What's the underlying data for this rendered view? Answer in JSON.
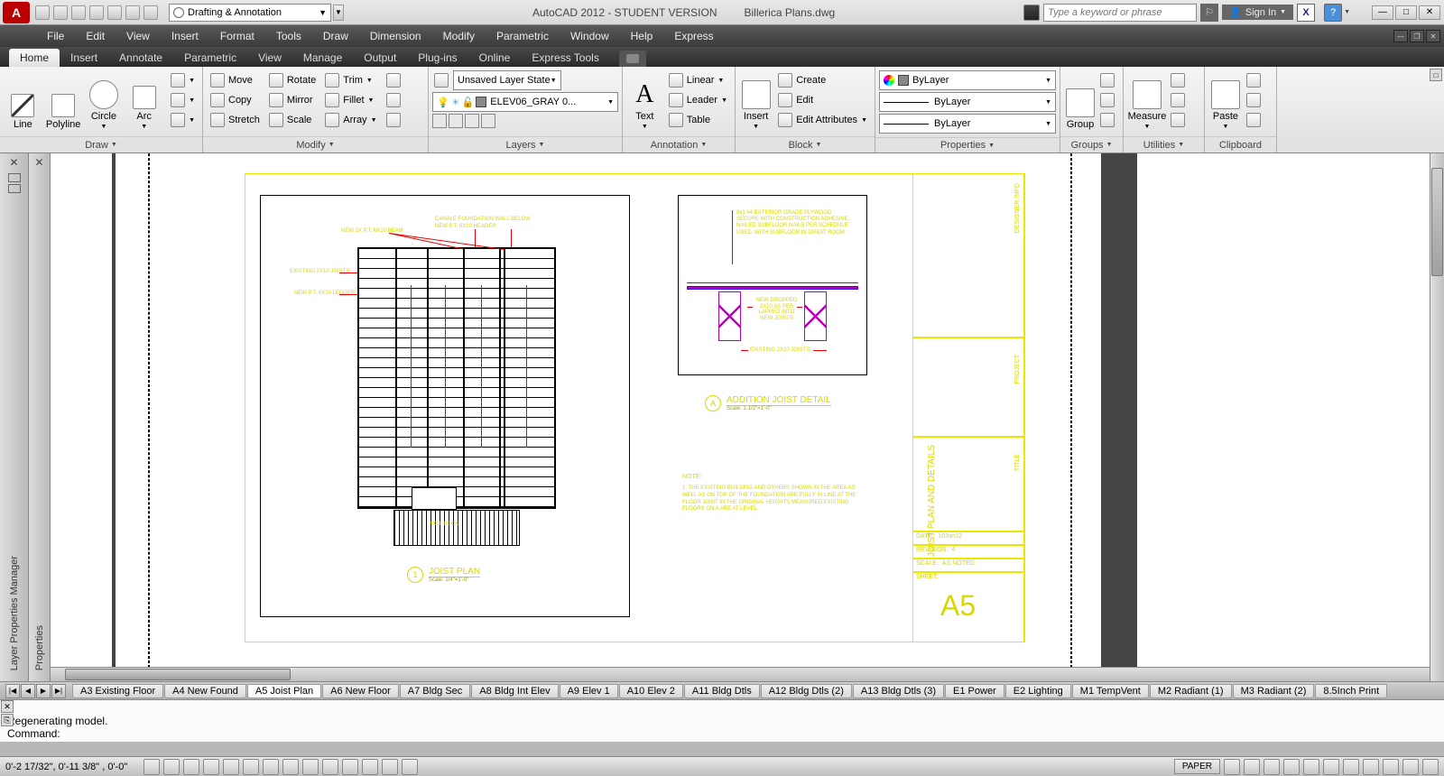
{
  "title": {
    "app": "AutoCAD 2012 - STUDENT VERSION",
    "file": "Billerica Plans.dwg"
  },
  "workspace": "Drafting & Annotation",
  "search": {
    "placeholder": "Type a keyword or phrase"
  },
  "signin": "Sign In",
  "menus": [
    "File",
    "Edit",
    "View",
    "Insert",
    "Format",
    "Tools",
    "Draw",
    "Dimension",
    "Modify",
    "Parametric",
    "Window",
    "Help",
    "Express"
  ],
  "tabs": [
    "Home",
    "Insert",
    "Annotate",
    "Parametric",
    "View",
    "Manage",
    "Output",
    "Plug-ins",
    "Online",
    "Express Tools"
  ],
  "active_tab": "Home",
  "ribbon": {
    "draw": {
      "title": "Draw",
      "line": "Line",
      "polyline": "Polyline",
      "circle": "Circle",
      "arc": "Arc"
    },
    "modify": {
      "title": "Modify",
      "move": "Move",
      "copy": "Copy",
      "stretch": "Stretch",
      "rotate": "Rotate",
      "mirror": "Mirror",
      "scale": "Scale",
      "trim": "Trim",
      "fillet": "Fillet",
      "array": "Array"
    },
    "layers": {
      "title": "Layers",
      "state": "Unsaved Layer State",
      "current": "ELEV06_GRAY 0..."
    },
    "annotation": {
      "title": "Annotation",
      "text": "Text",
      "linear": "Linear",
      "leader": "Leader",
      "table": "Table"
    },
    "block": {
      "title": "Block",
      "insert": "Insert",
      "create": "Create",
      "edit": "Edit",
      "editattr": "Edit Attributes"
    },
    "properties": {
      "title": "Properties",
      "bylayer": "ByLayer"
    },
    "groups": {
      "title": "Groups",
      "group": "Group"
    },
    "utilities": {
      "title": "Utilities",
      "measure": "Measure"
    },
    "clipboard": {
      "title": "Clipboard",
      "paste": "Paste"
    }
  },
  "palettes": {
    "p1": "Layer Properties Manager",
    "p2": "Properties"
  },
  "drawing": {
    "title1": "JOIST PLAN",
    "scale1": "Scale: 1/4\"=1'-0\"",
    "title2": "ADDITION JOIST DETAIL",
    "scale2": "Scale: 1-1/2\"=1'-0\"",
    "sheet": "A5",
    "sidebar_title": "JOIST PLAN AND DETAILS",
    "note_head": "NOTE:",
    "note_body": "1. THE EXISTING BUILDING AND OTHERS SHOWN IN THE AREA AS WELL AS ON TOP OF THE FOUNDATION ARE FULLY IN LINE AT THE FLOOR JOINT IN THE ORIGINAL HEIGHTS MEASURED EXISTING FLOORS ON A ARE AT LEVEL.",
    "detail_note": "8x1 #4 EXTERIOR GRADE PLYWOOD SECURE WITH CONSTRUCTION ADHESIVE, NAILED SUBFLOOR NAILS PER SCHEDULE USED, WITH SUBFLOOR IN GREAT ROOM",
    "detail_mid": "NEW DROPPED 2X10 AS PER LAPPED INTO NEW JOISTS",
    "detail_bot": "EXISTING 2X10 JOISTS",
    "side": {
      "date": "DATE:",
      "date_v": "10Jun12",
      "rev": "REVISION:",
      "rev_v": "4",
      "scale": "SCALE:",
      "scale_v": "AS NOTED",
      "sheet_l": "SHEET:",
      "designer": "DESIGNER INFO",
      "project": "PROJECT",
      "tl": "TITLE"
    },
    "labels": {
      "l1": "CANALE FOUNDATION WALL BELOW",
      "l2": "NEW P.T. 6X10 HEADER",
      "l3": "NEW 2X P.T. 6X10 BEAM",
      "l4": "EXISTING 2X10 JOISTS",
      "l5": "NEW P.T. 6X10 LEDGER",
      "l6": "4X10 DECK"
    },
    "marker_a": "A",
    "marker_1": "1"
  },
  "layout_tabs": [
    "A3 Existing Floor",
    "A4 New Found",
    "A5 Joist Plan",
    "A6 New Floor",
    "A7 Bldg Sec",
    "A8 Bldg Int Elev",
    "A9 Elev 1",
    "A10 Elev 2",
    "A11 Bldg Dtls",
    "A12 Bldg Dtls (2)",
    "A13 Bldg Dtls (3)",
    "E1 Power",
    "E2 Lighting",
    "M1 TempVent",
    "M2 Radiant (1)",
    "M3 Radiant (2)",
    "8.5Inch Print"
  ],
  "active_layout": "A5 Joist Plan",
  "command": {
    "line1": "Regenerating model.",
    "prompt": "Command:"
  },
  "status": {
    "coords": "0'-2 17/32\", 0'-11 3/8\" , 0'-0\"",
    "paper": "PAPER"
  }
}
